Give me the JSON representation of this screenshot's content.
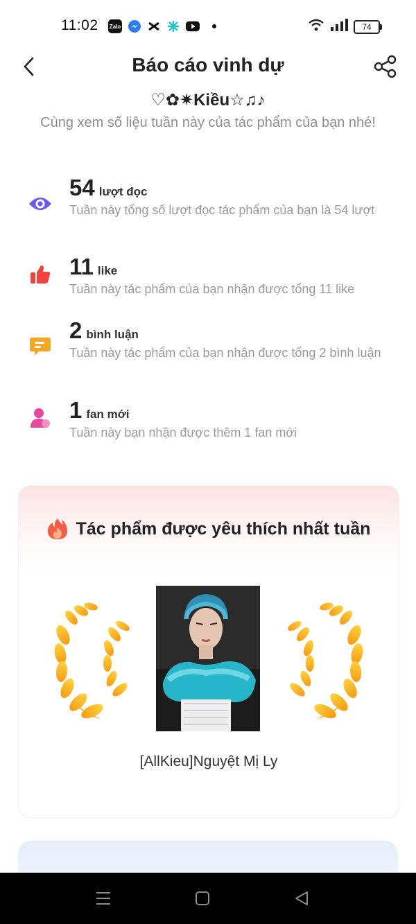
{
  "status_bar": {
    "time": "11:02",
    "battery": "74",
    "app_icons": [
      "zalo-icon",
      "messenger-icon",
      "capcut-icon",
      "app-icon",
      "youtube-icon"
    ]
  },
  "header": {
    "title": "Báo cáo vinh dự"
  },
  "profile": {
    "name": "♡✿✷Kiều☆♫♪",
    "subtitle": "Cùng xem số liệu tuần này của tác phẩm của bạn nhé!"
  },
  "stats": [
    {
      "value": "54",
      "unit": "lượt đọc",
      "desc": "Tuần này tổng số lượt đọc tác phẩm của bạn là 54 lượt",
      "icon": "eye-icon",
      "color": "#6b5ce7"
    },
    {
      "value": "11",
      "unit": "like",
      "desc": "Tuần này tác phẩm của bạn nhận được tổng 11 like",
      "icon": "thumbs-up-icon",
      "color": "#f0443e"
    },
    {
      "value": "2",
      "unit": "bình luận",
      "desc": "Tuần này tác phẩm của bạn nhận được tổng 2 bình luận",
      "icon": "comment-icon",
      "color": "#f5a623"
    },
    {
      "value": "1",
      "unit": "fan mới",
      "desc": "Tuần này bạn nhận được thêm 1 fan mới",
      "icon": "person-icon",
      "color": "#e8479b"
    }
  ],
  "favorite": {
    "heading": "Tác phẩm được yêu thích nhất tuần",
    "book_title": "[AllKieu]Nguyệt Mị Ly"
  },
  "colors": {
    "accent_gold": "#f7b523",
    "card_pink": "#fde3e3",
    "card_blue": "#e6eefb"
  }
}
